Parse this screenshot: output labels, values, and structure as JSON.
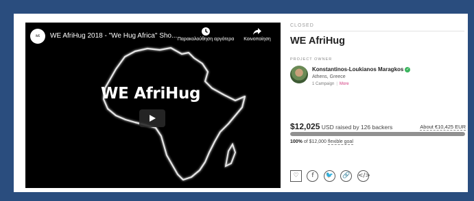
{
  "video": {
    "channel_avatar_text": "WE AfriHug",
    "title": "WE AfriHug 2018 - \"We Hug Africa\" Sho...",
    "watch_later_label": "Παρακολούθηση αργότερα",
    "share_label": "Κοινοποίηση",
    "overlay_title": "WE AfriHug"
  },
  "campaign": {
    "status": "CLOSED",
    "title": "WE AfriHug",
    "owner_label": "PROJECT OWNER",
    "owner": {
      "name": "Konstantinos-Loukianos Maragkos",
      "location": "Athens, Greece",
      "campaigns": "1 Campaign",
      "more": "More"
    },
    "funding": {
      "amount": "$12,025",
      "raised_text": "USD raised by 126 backers",
      "about": "About €10,425 EUR",
      "percent_label": "100%",
      "goal_text": "of $12,000",
      "goal_type": "flexible goal",
      "progress_fraction": 1.0
    }
  },
  "share_icons": {
    "heart": "♡",
    "facebook": "f",
    "twitter": "🐦",
    "link": "🔗",
    "embed": "</>"
  },
  "colors": {
    "background": "#2a4d7e",
    "verified": "#3bb55e",
    "more_link": "#d1357b",
    "progress": "#909090"
  }
}
